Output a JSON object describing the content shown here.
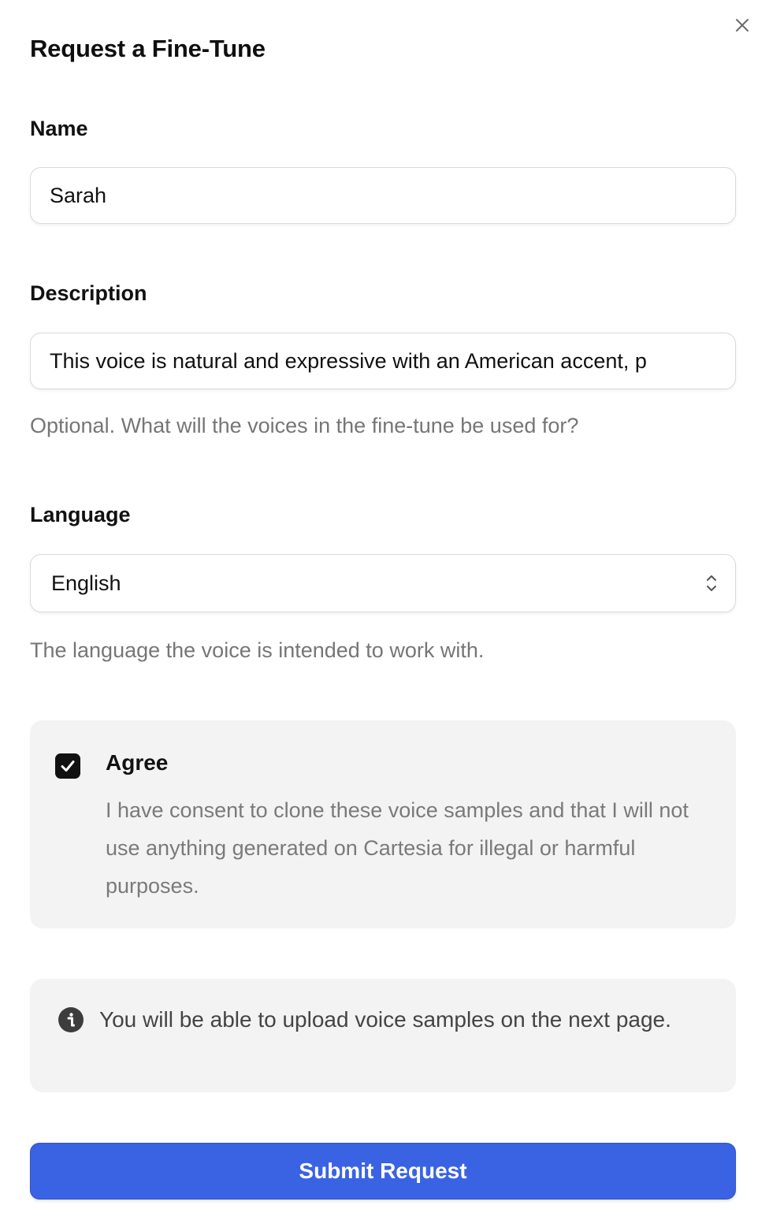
{
  "dialog": {
    "title": "Request a Fine-Tune",
    "close_icon": "close-icon"
  },
  "name_field": {
    "label": "Name",
    "value": "Sarah"
  },
  "description_field": {
    "label": "Description",
    "value": "This voice is natural and expressive with an American accent, p",
    "hint": "Optional. What will the voices in the fine-tune be used for?"
  },
  "language_field": {
    "label": "Language",
    "selected": "English",
    "hint": "The language the voice is intended to work with.",
    "icon": "chevron-up-down-icon"
  },
  "consent": {
    "checked": true,
    "label": "Agree",
    "text": "I have consent to clone these voice samples and that I will not use anything generated on Cartesia for illegal or harmful purposes."
  },
  "info": {
    "icon": "info-icon",
    "text": "You will be able to upload voice samples on the next page."
  },
  "submit": {
    "label": "Submit Request",
    "color": "#3a63e3"
  }
}
